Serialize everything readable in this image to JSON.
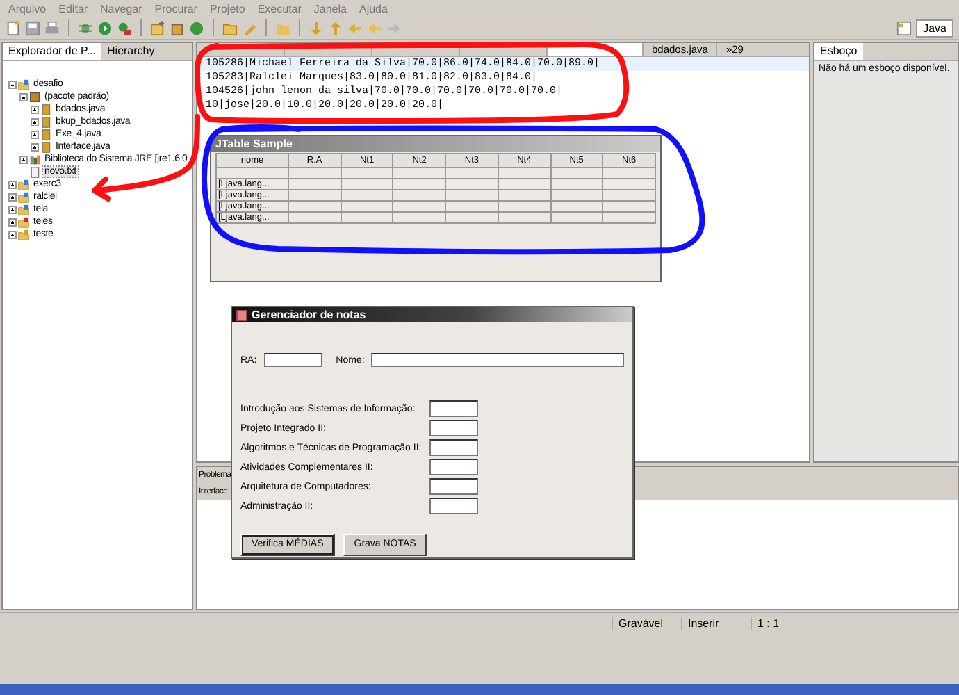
{
  "menu": [
    "Arquivo",
    "Editar",
    "Navegar",
    "Procurar",
    "Projeto",
    "Executar",
    "Janela",
    "Ajuda"
  ],
  "perspective": {
    "label": "Java",
    "selected": true
  },
  "explorer": {
    "tabs": [
      {
        "label": "Explorador de P...",
        "selected": true
      },
      {
        "label": "Hierarchy",
        "selected": false
      }
    ],
    "tree": [
      {
        "label": "desafio",
        "kind": "project",
        "expanded": true,
        "selected": false,
        "children": [
          {
            "label": "(pacote padrão)",
            "kind": "package",
            "expanded": true,
            "selected": false,
            "children": [
              {
                "label": "bdados.java",
                "kind": "java",
                "expanded": false,
                "selected": false
              },
              {
                "label": "bkup_bdados.java",
                "kind": "java",
                "expanded": false,
                "selected": false
              },
              {
                "label": "Exe_4.java",
                "kind": "java",
                "expanded": false,
                "selected": false
              },
              {
                "label": "Interface.java",
                "kind": "java",
                "expanded": false,
                "selected": false
              }
            ]
          },
          {
            "label": "Biblioteca do Sistema JRE [jre1.6.0",
            "kind": "library",
            "expanded": false,
            "selected": false
          },
          {
            "label": "novo.txt",
            "kind": "text",
            "selected": true
          }
        ]
      },
      {
        "label": "exerc3",
        "kind": "project",
        "expanded": false,
        "selected": false
      },
      {
        "label": "ralclei",
        "kind": "project",
        "expanded": false,
        "selected": false
      },
      {
        "label": "tela",
        "kind": "project",
        "expanded": false,
        "selected": false
      },
      {
        "label": "teles",
        "kind": "error-project",
        "expanded": false,
        "selected": false
      },
      {
        "label": "teste",
        "kind": "warning-project",
        "expanded": false,
        "selected": false
      }
    ]
  },
  "editor": {
    "tabs": [
      {
        "label": "bdados.java",
        "selected": false
      }
    ],
    "overflow": "»29",
    "lines": [
      {
        "text": "105286|Michael Ferreira da Silva|70.0|86.0|74.0|84.0|70.0|89.0|",
        "selected": true
      },
      {
        "text": "105283|Ralclei Marques|83.0|80.0|81.0|82.0|83.0|84.0|",
        "selected": false
      },
      {
        "text": "104526|john lenon da silva|70.0|70.0|70.0|70.0|70.0|70.0|",
        "selected": false
      },
      {
        "text": "10|jose|20.0|10.0|20.0|20.0|20.0|20.0|",
        "selected": false
      }
    ]
  },
  "outline": {
    "title": "Esboço",
    "message": "Não há um esboço disponível."
  },
  "table_window": {
    "title": "JTable Sample",
    "columns": [
      "nome",
      "R.A",
      "Nt1",
      "Nt2",
      "Nt3",
      "Nt4",
      "Nt5",
      "Nt6"
    ],
    "rows": [
      "[Ljava.lang...",
      "[Ljava.lang...",
      "[Ljava.lang...",
      "[Ljava.lang..."
    ]
  },
  "form_window": {
    "title": "Gerenciador de notas",
    "ra_label": "RA:",
    "name_label": "Nome:",
    "subjects": [
      "Introdução aos Sistemas de Informação:",
      "Projeto Integrado II:",
      "Algoritmos e Técnicas de Programação II:",
      "Atividades Complementares II:",
      "Arquitetura de Computadores:",
      "Administração II:"
    ],
    "buttons": [
      {
        "label": "Verifica MÉDIAS",
        "focused": true
      },
      {
        "label": "Grava NOTAS",
        "focused": false
      }
    ]
  },
  "bottom_panel": {
    "tabs": [
      "Problema",
      "Interface"
    ]
  },
  "status_bar": [
    "Gravável",
    "Inserir",
    "1 : 1"
  ]
}
